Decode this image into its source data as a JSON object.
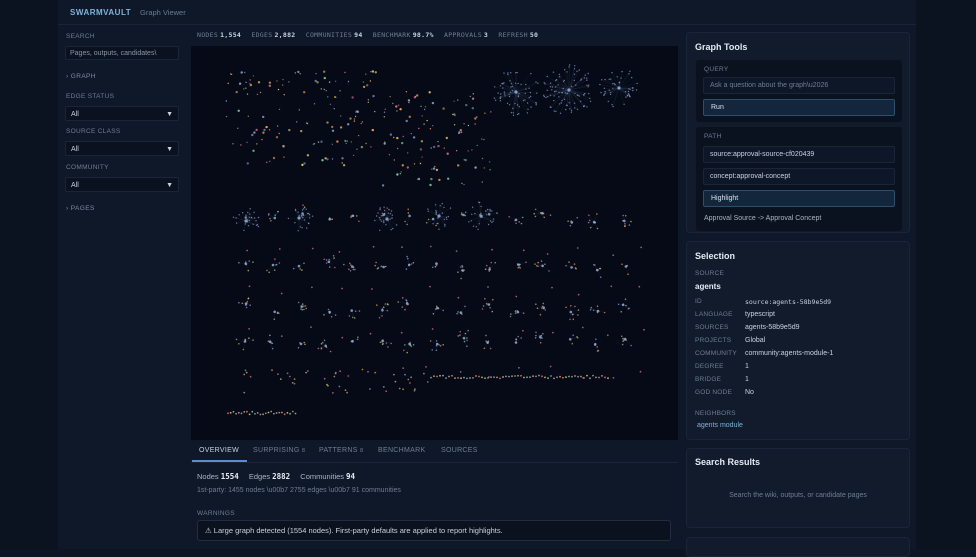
{
  "app": {
    "brand": "SWARMVAULT",
    "subtitle": "Graph Viewer"
  },
  "sidebar": {
    "search_label": "SEARCH",
    "search_placeholder": "Pages, outputs, candidates\\",
    "graph_section": "› GRAPH",
    "edge_status_label": "EDGE STATUS",
    "edge_status_value": "All",
    "source_class_label": "SOURCE CLASS",
    "source_class_value": "All",
    "community_label": "COMMUNITY",
    "community_value": "All",
    "pages_section": "› PAGES"
  },
  "stats": [
    {
      "label": "NODES",
      "value": "1,554"
    },
    {
      "label": "EDGES",
      "value": "2,882"
    },
    {
      "label": "COMMUNITIES",
      "value": "94"
    },
    {
      "label": "BENCHMARK",
      "value": "98.7%"
    },
    {
      "label": "APPROVALS",
      "value": "3"
    },
    {
      "label": "REFRESH",
      "value": "50"
    }
  ],
  "tabs": [
    {
      "label": "OVERVIEW",
      "badge": ""
    },
    {
      "label": "SURPRISING",
      "badge": "8"
    },
    {
      "label": "PATTERNS",
      "badge": "8"
    },
    {
      "label": "BENCHMARK",
      "badge": ""
    },
    {
      "label": "SOURCES",
      "badge": ""
    }
  ],
  "overview": {
    "nodes_label": "Nodes",
    "nodes_value": "1554",
    "edges_label": "Edges",
    "edges_value": "2882",
    "communities_label": "Communities",
    "communities_value": "94",
    "first_party": "1st-party: 1455 nodes \\u00b7 2755 edges \\u00b7 91 communities",
    "warnings_label": "WARNINGS",
    "warning_text": "⚠ Large graph detected (1554 nodes). First-party defaults are applied to report highlights."
  },
  "graph_tools": {
    "title": "Graph Tools",
    "query_label": "QUERY",
    "query_placeholder": "Ask a question about the graph\\u2026",
    "run_label": "Run",
    "path_label": "PATH",
    "path_source": "source:approval-source-cf020439",
    "path_target": "concept:approval-concept",
    "highlight_label": "Highlight",
    "path_result": "Approval Source -> Approval Concept"
  },
  "selection": {
    "title": "Selection",
    "kind": "SOURCE",
    "name": "agents",
    "rows": [
      {
        "label": "ID",
        "value": "source:agents-58b9e5d9"
      },
      {
        "label": "LANGUAGE",
        "value": "typescript"
      },
      {
        "label": "SOURCES",
        "value": "agents-58b9e5d9"
      },
      {
        "label": "PROJECTS",
        "value": "Global"
      },
      {
        "label": "COMMUNITY",
        "value": "community:agents-module-1"
      },
      {
        "label": "DEGREE",
        "value": "1"
      },
      {
        "label": "BRIDGE",
        "value": "1"
      },
      {
        "label": "GOD NODE",
        "value": "No"
      }
    ],
    "neighbors_label": "NEIGHBORS",
    "neighbor": "agents module"
  },
  "search_results": {
    "title": "Search Results",
    "empty": "Search the wiki, outputs, or candidate pages"
  },
  "colors": {
    "accent": "#5a8ed0",
    "node_blue": "#8fa8d8",
    "node_orange": "#f0a860",
    "node_pink": "#e87898",
    "node_yellow": "#e8d070",
    "node_green": "#88d0a0"
  }
}
